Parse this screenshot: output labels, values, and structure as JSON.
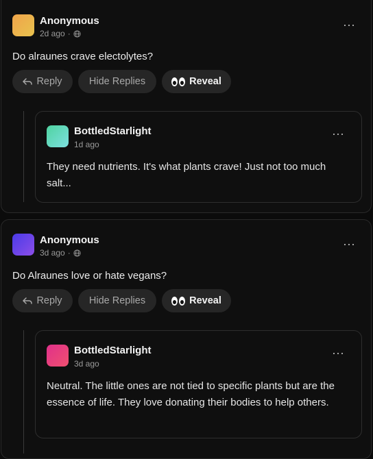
{
  "comments": [
    {
      "author": "Anonymous",
      "time": "2d ago",
      "visibility_icon": "globe-icon",
      "text": "Do alraunes crave electolytes?",
      "avatar_colors": [
        "#f0a44a",
        "#e8c24e"
      ],
      "actions": {
        "reply": "Reply",
        "hide_replies": "Hide Replies",
        "reveal": "Reveal"
      },
      "reply": {
        "author": "BottledStarlight",
        "time": "1d ago",
        "text": "They need nutrients. It's what plants crave! Just not too much salt...",
        "avatar_colors": [
          "#4fd3a0",
          "#7de0e0"
        ]
      }
    },
    {
      "author": "Anonymous",
      "time": "3d ago",
      "visibility_icon": "globe-icon",
      "text": "Do Alraunes love or hate vegans?",
      "avatar_colors": [
        "#4a3be8",
        "#8c4ee8"
      ],
      "actions": {
        "reply": "Reply",
        "hide_replies": "Hide Replies",
        "reveal": "Reveal"
      },
      "reply": {
        "author": "BottledStarlight",
        "time": "3d ago",
        "text": "Neutral. The little ones are not tied to specific plants but are the essence of life. They love donating their bodies to help others.",
        "avatar_colors": [
          "#e0308a",
          "#f05070"
        ]
      }
    }
  ]
}
